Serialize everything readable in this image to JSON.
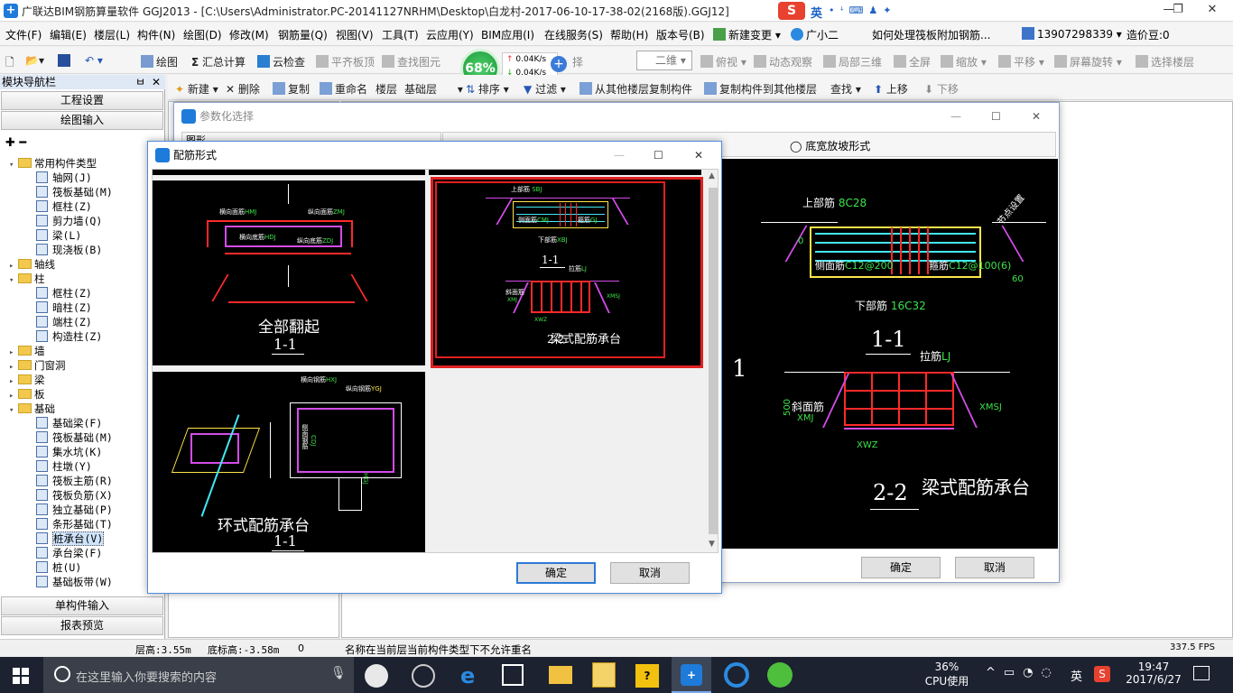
{
  "window": {
    "title": "广联达BIM钢筋算量软件 GGJ2013 - [C:\\Users\\Administrator.PC-20141127NRHM\\Desktop\\白龙村-2017-06-10-17-38-02(2168版).GGJ12]",
    "minimize": "—",
    "maximize": "❐",
    "close": "✕"
  },
  "ime": {
    "label": "英"
  },
  "menu": [
    "文件(F)",
    "编辑(E)",
    "楼层(L)",
    "构件(N)",
    "绘图(D)",
    "修改(M)",
    "钢筋量(Q)",
    "视图(V)",
    "工具(T)",
    "云应用(Y)",
    "BIM应用(I)",
    "在线服务(S)",
    "帮助(H)",
    "版本号(B)"
  ],
  "menu_extra": {
    "new_change": "新建变更",
    "assistant": "广小二",
    "question": "如何处理筏板附加钢筋...",
    "phone": "13907298339",
    "price": "造价豆:0"
  },
  "toolbar": {
    "draw": "绘图",
    "sum": "汇总计算",
    "cloud_check": "云检查",
    "flat_top": "平齐板顶",
    "find": "查找图元",
    "select_floor": "择",
    "view_mode": "二维",
    "top_view": "俯视",
    "dynamic": "动态观察",
    "local3d": "局部三维",
    "fullscreen": "全屏",
    "zoom": "缩放",
    "pan": "平移",
    "rotate": "屏幕旋转",
    "select_layer": "选择楼层",
    "speed_pct": "68%",
    "speed_up": "0.04K/s",
    "speed_down": "0.04K/s"
  },
  "toolbar2": {
    "new": "新建",
    "delete": "删除",
    "copy": "复制",
    "rename": "重命名",
    "floor_label": "楼层",
    "floor_value": "基础层",
    "sort": "排序",
    "filter": "过滤",
    "copy_from": "从其他楼层复制构件",
    "copy_to": "复制构件到其他楼层",
    "search": "查找",
    "up": "上移",
    "down": "下移"
  },
  "panel": {
    "title": "模块导航栏",
    "pin": "ㅂ",
    "close": "✕",
    "project_settings": "工程设置",
    "draw_input": "绘图输入",
    "single_input": "单构件输入",
    "report_preview": "报表预览",
    "tree": [
      {
        "level": 0,
        "exp": "▾",
        "type": "folder",
        "label": "常用构件类型"
      },
      {
        "level": 1,
        "type": "comp",
        "label": "轴网(J)"
      },
      {
        "level": 1,
        "type": "comp",
        "label": "筏板基础(M)"
      },
      {
        "level": 1,
        "type": "comp",
        "label": "框柱(Z)"
      },
      {
        "level": 1,
        "type": "comp",
        "label": "剪力墙(Q)"
      },
      {
        "level": 1,
        "type": "comp",
        "label": "梁(L)"
      },
      {
        "level": 1,
        "type": "comp",
        "label": "现浇板(B)"
      },
      {
        "level": 0,
        "exp": "▸",
        "type": "folder",
        "label": "轴线"
      },
      {
        "level": 0,
        "exp": "▾",
        "type": "folder",
        "label": "柱"
      },
      {
        "level": 1,
        "type": "comp",
        "label": "框柱(Z)"
      },
      {
        "level": 1,
        "type": "comp",
        "label": "暗柱(Z)"
      },
      {
        "level": 1,
        "type": "comp",
        "label": "端柱(Z)"
      },
      {
        "level": 1,
        "type": "comp",
        "label": "构造柱(Z)"
      },
      {
        "level": 0,
        "exp": "▸",
        "type": "folder",
        "label": "墙"
      },
      {
        "level": 0,
        "exp": "▸",
        "type": "folder",
        "label": "门窗洞"
      },
      {
        "level": 0,
        "exp": "▸",
        "type": "folder",
        "label": "梁"
      },
      {
        "level": 0,
        "exp": "▸",
        "type": "folder",
        "label": "板"
      },
      {
        "level": 0,
        "exp": "▾",
        "type": "folder",
        "label": "基础"
      },
      {
        "level": 1,
        "type": "comp",
        "label": "基础梁(F)"
      },
      {
        "level": 1,
        "type": "comp",
        "label": "筏板基础(M)"
      },
      {
        "level": 1,
        "type": "comp",
        "label": "集水坑(K)"
      },
      {
        "level": 1,
        "type": "comp",
        "label": "柱墩(Y)"
      },
      {
        "level": 1,
        "type": "comp",
        "label": "筏板主筋(R)"
      },
      {
        "level": 1,
        "type": "comp",
        "label": "筏板负筋(X)"
      },
      {
        "level": 1,
        "type": "comp",
        "label": "独立基础(P)"
      },
      {
        "level": 1,
        "type": "comp",
        "label": "条形基础(T)"
      },
      {
        "level": 1,
        "type": "comp",
        "label": "桩承台(V)",
        "selected": true
      },
      {
        "level": 1,
        "type": "comp",
        "label": "承台梁(F)"
      },
      {
        "level": 1,
        "type": "comp",
        "label": "桩(U)"
      },
      {
        "level": 1,
        "type": "comp",
        "label": "基础板带(W)"
      }
    ]
  },
  "param_dialog": {
    "title": "参数化选择",
    "left_header": "图形",
    "radio_label": "底宽放坡形式",
    "ok": "确定",
    "cancel": "取消",
    "preview": {
      "top_rebar": "上部筋",
      "top_rebar_val": "8C28",
      "side_rebar": "侧面筋",
      "side_rebar_val": "C12@200",
      "stirrup": "箍筋",
      "stirrup_val": "C12@100(6)",
      "bottom_rebar": "下部筋",
      "bottom_rebar_val": "16C32",
      "section1": "1-1",
      "tie": "拉筋",
      "tie_val": "LJ",
      "slope_rebar": "斜面筋",
      "slope_code": "XMJ",
      "xmsj": "XMSJ",
      "xwz": "XWZ",
      "dim_500": "500",
      "dim_0": "0",
      "dim_60": "60",
      "section2": "2-2",
      "caption": "梁式配筋承台",
      "big_1": "1",
      "bend": "节点设置"
    }
  },
  "rebar_dialog": {
    "title": "配筋形式",
    "ok": "确定",
    "cancel": "取消",
    "tile1": {
      "caption": "全部翻起",
      "section": "1-1",
      "hj": "横向面筋",
      "hj_code": "HMJ",
      "zj": "纵向面筋",
      "zj_code": "ZMJ",
      "hdj": "横向底筋",
      "hdj_code": "HDJ",
      "zdj": "纵向底筋",
      "zdj_code": "ZDJ"
    },
    "tile2": {
      "caption": "梁式配筋承台",
      "section1": "1-1",
      "section2": "2-2",
      "top": "上部筋",
      "top_code": "SBJ",
      "side": "侧面筋",
      "side_code": "CMJ",
      "stir": "箍筋",
      "stir_code": "GJ",
      "bottom": "下部筋",
      "bottom_code": "XBJ",
      "tie": "拉筋",
      "tie_code": "LJ",
      "slope": "斜面筋",
      "xmj": "XMJ",
      "xmsj": "XMSJ",
      "xwz": "XWZ"
    },
    "tile3": {
      "caption": "环式配筋承台",
      "section": "1-1",
      "hxj": "横向钢筋",
      "hxj_code": "HXJ",
      "zxj": "纵向钢筋",
      "zxj_code": "YGJ",
      "cdj": "侧面钢筋",
      "cdj_code": "CDJ",
      "hgj_code": "HGJ"
    }
  },
  "status": {
    "floor_height": "层高:3.55m",
    "base_height": "底标高:-3.58m",
    "zero": "0",
    "message": "名称在当前层当前构件类型下不允许重名",
    "fps": "337.5 FPS"
  },
  "taskbar": {
    "search_placeholder": "在这里输入你要搜索的内容",
    "cpu_pct": "36%",
    "cpu_label": "CPU使用",
    "ime": "英",
    "time": "19:47",
    "date": "2017/6/27"
  }
}
